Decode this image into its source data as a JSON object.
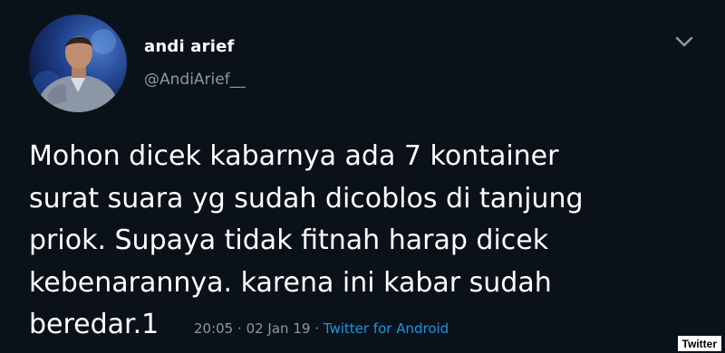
{
  "tweet": {
    "display_name": "andi arief",
    "handle": "@AndiArief__",
    "text_lines": [
      "Mohon dicek kabarnya ada 7 kontainer",
      "surat suara yg sudah dicoblos di tanjung",
      "priok. Supaya tidak fitnah harap dicek",
      "kebenarannya. karena ini kabar sudah",
      "beredar.1"
    ],
    "time": "20:05",
    "separator": "·",
    "date": "02 Jan 19",
    "source": "Twitter for Android",
    "menu_icon": "chevron-down-icon",
    "avatar_icon": "avatar"
  },
  "watermark": "Twitter",
  "colors": {
    "background": "#0b1118",
    "text": "#ffffff",
    "secondary": "#8899a6",
    "link": "#1b95e0"
  }
}
